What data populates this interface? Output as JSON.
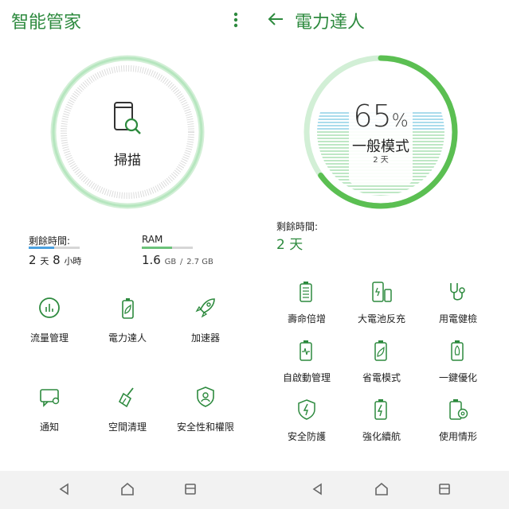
{
  "left": {
    "title": "智能管家",
    "scan_label": "掃描",
    "remaining": {
      "label": "剩餘時間:",
      "num1": "2",
      "unit1": "天",
      "num2": "8",
      "unit2": "小時",
      "level": 0.5
    },
    "ram": {
      "label": "RAM",
      "used": "1.6",
      "used_unit": "GB",
      "sep": "/",
      "total": "2.7 GB",
      "level": 0.59
    },
    "tiles": [
      {
        "label": "流量管理",
        "icon": "data-usage-icon"
      },
      {
        "label": "電力達人",
        "icon": "battery-leaf-icon"
      },
      {
        "label": "加速器",
        "icon": "rocket-icon"
      },
      {
        "label": "通知",
        "icon": "notification-icon"
      },
      {
        "label": "空間清理",
        "icon": "broom-icon"
      },
      {
        "label": "安全性和權限",
        "icon": "shield-user-icon"
      }
    ]
  },
  "right": {
    "title": "電力達人",
    "battery": {
      "percent": "65",
      "percent_sign": "%",
      "mode": "一般模式",
      "days_num": "2",
      "days_unit": "天",
      "level": 0.65
    },
    "remaining": {
      "label": "剩餘時間:",
      "value": "2 天"
    },
    "tiles": [
      {
        "label": "壽命倍增",
        "icon": "battery-lifespan-icon"
      },
      {
        "label": "大電池反充",
        "icon": "phone-charge-icon"
      },
      {
        "label": "用電健檢",
        "icon": "stethoscope-icon"
      },
      {
        "label": "自啟動管理",
        "icon": "battery-autostart-icon"
      },
      {
        "label": "省電模式",
        "icon": "battery-leaf-icon"
      },
      {
        "label": "一鍵優化",
        "icon": "battery-rocket-icon"
      },
      {
        "label": "安全防護",
        "icon": "shield-bolt-icon"
      },
      {
        "label": "強化續航",
        "icon": "battery-bolt-icon"
      },
      {
        "label": "使用情形",
        "icon": "battery-gear-icon"
      }
    ]
  },
  "colors": {
    "accent": "#2d8a3e",
    "ring_light": "#a8dfb2",
    "ring_dark": "#5bbf52",
    "water": "#8ed0e6",
    "bar": "#4aa0e0"
  },
  "nav": {
    "back": "back-icon",
    "home": "home-icon",
    "recents": "recents-icon"
  }
}
